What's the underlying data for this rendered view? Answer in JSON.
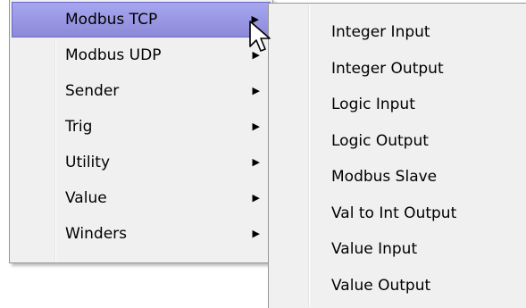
{
  "main_menu": {
    "items": [
      {
        "label": "Modbus TCP",
        "has_submenu": true,
        "highlighted": true
      },
      {
        "label": "Modbus UDP",
        "has_submenu": true,
        "highlighted": false
      },
      {
        "label": "Sender",
        "has_submenu": true,
        "highlighted": false
      },
      {
        "label": "Trig",
        "has_submenu": true,
        "highlighted": false
      },
      {
        "label": "Utility",
        "has_submenu": true,
        "highlighted": false
      },
      {
        "label": "Value",
        "has_submenu": true,
        "highlighted": false
      },
      {
        "label": "Winders",
        "has_submenu": true,
        "highlighted": false
      }
    ],
    "arrow_icon": "chevron-right-icon",
    "highlight_color": "#9b99e6"
  },
  "sub_menu": {
    "items": [
      {
        "label": "Integer Input"
      },
      {
        "label": "Integer Output"
      },
      {
        "label": "Logic Input"
      },
      {
        "label": "Logic Output"
      },
      {
        "label": "Modbus Slave"
      },
      {
        "label": "Val to Int Output"
      },
      {
        "label": "Value Input"
      },
      {
        "label": "Value Output"
      }
    ]
  },
  "cursor_icon": "mouse-pointer-icon"
}
